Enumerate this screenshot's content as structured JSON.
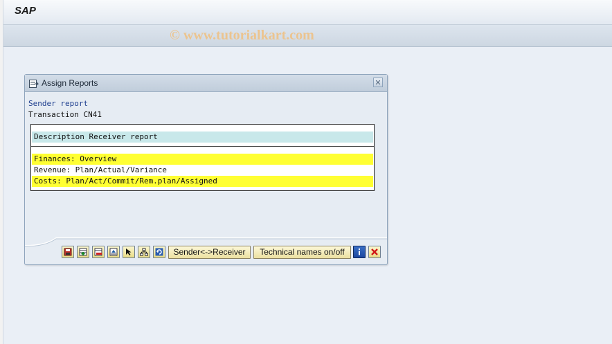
{
  "app": {
    "title": "SAP",
    "watermark": "© www.tutorialkart.com"
  },
  "dialog": {
    "title": "Assign Reports",
    "sender_label": "Sender report",
    "sender_value": "Transaction CN41",
    "list_header": "Description Receiver report",
    "rows": [
      {
        "label": "Finances: Overview",
        "highlighted": true
      },
      {
        "label": "Revenue: Plan/Actual/Variance",
        "highlighted": false
      },
      {
        "label": "Costs: Plan/Act/Commit/Rem.plan/Assigned",
        "highlighted": true
      }
    ],
    "buttons": {
      "sender_receiver": "Sender<->Receiver",
      "technical_names": "Technical names on/off"
    },
    "icons": [
      "save-icon",
      "insert-row-icon",
      "delete-row-icon",
      "move-up-icon",
      "select-icon",
      "hierarchy-icon",
      "refresh-icon",
      "info-icon",
      "cancel-icon"
    ]
  },
  "colors": {
    "highlight": "#ffff33",
    "header_row": "#c8e8ea",
    "background": "#eaeff6"
  }
}
